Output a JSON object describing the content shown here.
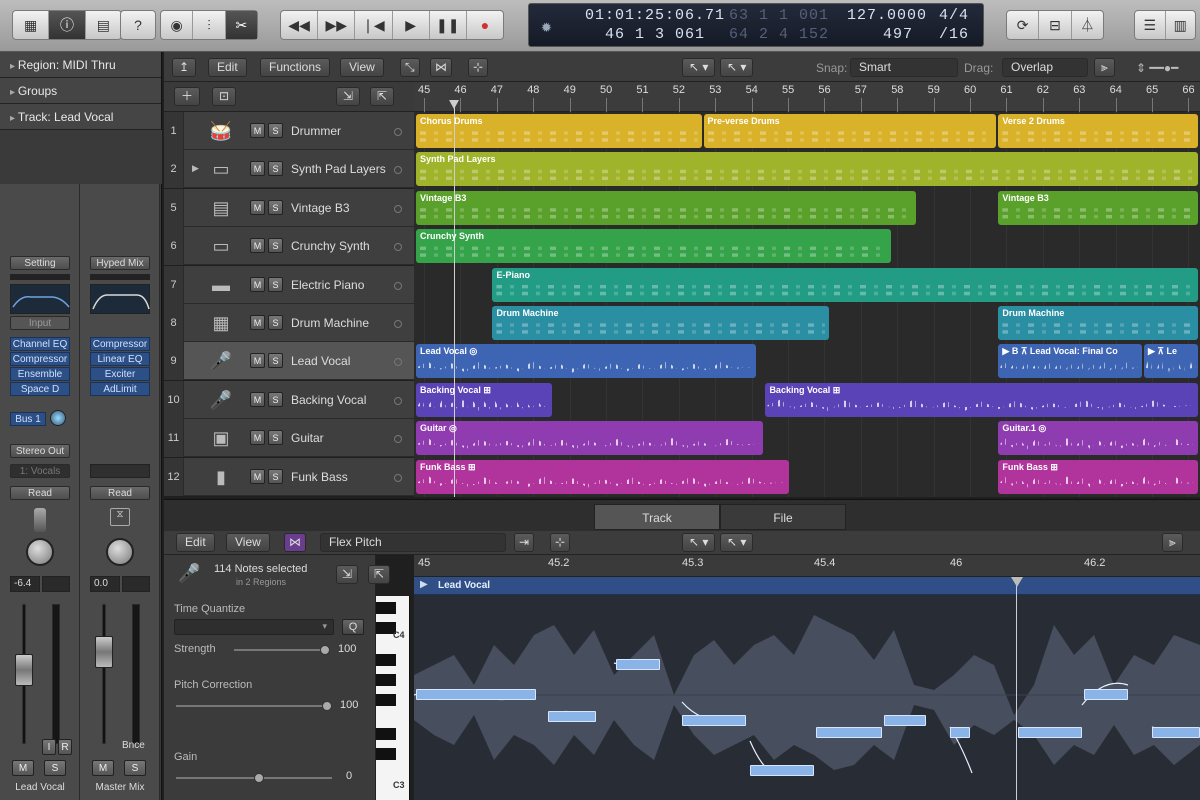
{
  "control_bar": {
    "play_glyph": "▶",
    "pause_glyph": "❚❚",
    "record_glyph": "●",
    "rewind_glyph": "◀◀",
    "forward_glyph": "▶▶",
    "tostart_glyph": "❘◀"
  },
  "lcd": {
    "time": "01:01:25:06.71",
    "time_dim": "63  1  1  001",
    "bars": "46  1  3  061",
    "bars_dim": "64  2  4  152",
    "tempo": "127.0000",
    "bpm_sub": "497",
    "signature": "4/4",
    "division": "/16"
  },
  "inspector": {
    "region": "Region: MIDI Thru",
    "groups": "Groups",
    "track": "Track:  Lead Vocal",
    "strip1": {
      "setting": "Setting",
      "input": "Input",
      "plugins": [
        "Channel EQ",
        "Compressor",
        "Ensemble",
        "Space D"
      ],
      "send": "Bus 1",
      "output": "Stereo Out",
      "group": "1: Vocals",
      "automation": "Read",
      "value": "-6.4",
      "name": "Lead Vocal",
      "m": "M",
      "s": "S",
      "i": "I",
      "r": "R"
    },
    "strip2": {
      "setting": "Hyped Mix",
      "plugins": [
        "Compressor",
        "Linear EQ",
        "Exciter",
        "AdLimit"
      ],
      "automation": "Read",
      "value": "0.0",
      "name": "Master Mix",
      "bnce": "Bnce",
      "m": "M",
      "s": "S"
    }
  },
  "tracks_toolbar": {
    "edit": "Edit",
    "functions": "Functions",
    "view": "View",
    "snap_label": "Snap:",
    "snap_value": "Smart",
    "drag_label": "Drag:",
    "drag_value": "Overlap"
  },
  "ruler": [
    "45",
    "46",
    "47",
    "48",
    "49",
    "50",
    "51",
    "52",
    "53",
    "54",
    "55",
    "56",
    "57",
    "58",
    "59",
    "60",
    "61",
    "62",
    "63",
    "64",
    "65",
    "66"
  ],
  "tracks": [
    {
      "num": "1",
      "name": "Drummer",
      "icon": "drummer-icon",
      "glyph": "🥁"
    },
    {
      "num": "2",
      "name": "Synth Pad Layers",
      "icon": "synth-icon",
      "glyph": "▭"
    },
    {
      "num": "5",
      "name": "Vintage B3",
      "icon": "organ-icon",
      "glyph": "▤"
    },
    {
      "num": "6",
      "name": "Crunchy Synth",
      "icon": "synth-icon",
      "glyph": "▭"
    },
    {
      "num": "7",
      "name": "Electric Piano",
      "icon": "piano-icon",
      "glyph": "▬"
    },
    {
      "num": "8",
      "name": "Drum Machine",
      "icon": "drum-machine-icon",
      "glyph": "▦"
    },
    {
      "num": "9",
      "name": "Lead Vocal",
      "icon": "microphone-icon",
      "glyph": "🎤"
    },
    {
      "num": "10",
      "name": "Backing Vocal",
      "icon": "microphone-icon",
      "glyph": "🎤"
    },
    {
      "num": "11",
      "name": "Guitar",
      "icon": "amp-icon",
      "glyph": "▣"
    },
    {
      "num": "12",
      "name": "Funk Bass",
      "icon": "amp-icon",
      "glyph": "▮"
    }
  ],
  "regions": [
    {
      "name": "Chorus Drums",
      "row": 0,
      "bar_start": 45,
      "bar_end": 52.9,
      "color": "#d9b22a",
      "kind": "midi"
    },
    {
      "name": "Pre-verse Drums",
      "row": 0,
      "bar_start": 52.9,
      "bar_end": 61,
      "color": "#d9b22a",
      "kind": "midi"
    },
    {
      "name": "Verse 2 Drums",
      "row": 0,
      "bar_start": 61,
      "bar_end": 66.9,
      "color": "#d9b22a",
      "kind": "midi"
    },
    {
      "name": "Synth Pad Layers",
      "row": 1,
      "bar_start": 45,
      "bar_end": 66.9,
      "color": "#9fb42a",
      "kind": "midi"
    },
    {
      "name": "Vintage B3",
      "row": 2,
      "bar_start": 45,
      "bar_end": 58.8,
      "color": "#5aa12c",
      "kind": "midi"
    },
    {
      "name": "Vintage B3",
      "row": 2,
      "bar_start": 61,
      "bar_end": 66.9,
      "color": "#5aa12c",
      "kind": "midi"
    },
    {
      "name": "Crunchy Synth",
      "row": 3,
      "bar_start": 45,
      "bar_end": 58.1,
      "color": "#35a34a",
      "kind": "midi"
    },
    {
      "name": "E-Piano",
      "row": 4,
      "bar_start": 47.1,
      "bar_end": 66.9,
      "color": "#239c86",
      "kind": "midi"
    },
    {
      "name": "Drum Machine",
      "row": 5,
      "bar_start": 47.1,
      "bar_end": 56.4,
      "color": "#2a8fa3",
      "kind": "midi"
    },
    {
      "name": "Drum Machine",
      "row": 5,
      "bar_start": 61,
      "bar_end": 66.9,
      "color": "#2a8fa3",
      "kind": "midi"
    },
    {
      "name": "Lead Vocal  ◎",
      "row": 6,
      "bar_start": 45,
      "bar_end": 54.4,
      "color": "#3e65b4",
      "kind": "audio"
    },
    {
      "name": "▶ B  ⊼ Lead Vocal: Final Co",
      "row": 6,
      "bar_start": 61,
      "bar_end": 65,
      "color": "#3e65b4",
      "kind": "audio"
    },
    {
      "name": "▶ ⊼ Le",
      "row": 6,
      "bar_start": 65,
      "bar_end": 66.9,
      "color": "#3e65b4",
      "kind": "audio"
    },
    {
      "name": "Backing Vocal  ⊞",
      "row": 7,
      "bar_start": 45,
      "bar_end": 48.8,
      "color": "#5a43b6",
      "kind": "audio"
    },
    {
      "name": "Backing Vocal  ⊞",
      "row": 7,
      "bar_start": 54.6,
      "bar_end": 66.9,
      "color": "#5a43b6",
      "kind": "audio"
    },
    {
      "name": "Guitar  ◎",
      "row": 8,
      "bar_start": 45,
      "bar_end": 54.6,
      "color": "#8e3cb0",
      "kind": "audio"
    },
    {
      "name": "Guitar.1  ◎",
      "row": 8,
      "bar_start": 61,
      "bar_end": 66.9,
      "color": "#8e3cb0",
      "kind": "audio"
    },
    {
      "name": "Funk Bass  ⊞",
      "row": 9,
      "bar_start": 45,
      "bar_end": 55.3,
      "color": "#b0349b",
      "kind": "audio"
    },
    {
      "name": "Funk Bass  ⊞",
      "row": 9,
      "bar_start": 61,
      "bar_end": 66.9,
      "color": "#b0349b",
      "kind": "audio"
    }
  ],
  "editor": {
    "tab_track": "Track",
    "tab_file": "File",
    "edit": "Edit",
    "view": "View",
    "mode": "Flex Pitch",
    "notes_selected": "114 Notes selected",
    "in_regions": "in 2 Regions",
    "time_quantize": "Time Quantize",
    "q": "Q",
    "strength": "Strength",
    "strength_value": "100",
    "pitch_correction": "Pitch Correction",
    "pitch_value": "100",
    "gain": "Gain",
    "gain_value": "0",
    "region_name": "Lead Vocal",
    "ruler": [
      "45",
      "45.2",
      "45.3",
      "45.4",
      "46",
      "46.2"
    ],
    "key_c4": "C4",
    "key_c3": "C3"
  }
}
